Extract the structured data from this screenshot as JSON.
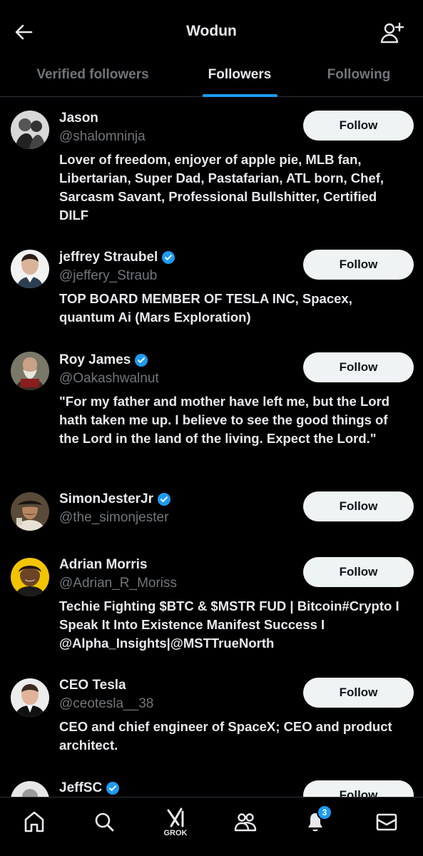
{
  "header": {
    "title": "Wodun",
    "back_icon": "arrow-left-icon",
    "add_user_icon": "person-add-icon"
  },
  "tabs": [
    {
      "label": "Verified followers",
      "active": false
    },
    {
      "label": "Followers",
      "active": true
    },
    {
      "label": "Following",
      "active": false
    }
  ],
  "colors": {
    "background": "#000000",
    "accent": "#1d9bf0",
    "secondary_text": "#71767b",
    "button_bg": "#eff3f4"
  },
  "followers": [
    {
      "name": "Jason",
      "handle": "@shalomninja",
      "verified": false,
      "bio": "Lover of freedom, enjoyer of apple pie, MLB fan, Libertarian, Super Dad, Pastafarian, ATL born, Chef, Sarcasm Savant, Professional Bullshitter, Certified DILF",
      "button": "Follow"
    },
    {
      "name": "jeffrey Straubel",
      "handle": "@jeffery_Straub",
      "verified": true,
      "bio": "TOP BOARD MEMBER OF TESLA INC, Spacex, quantum Ai (Mars Exploration)",
      "button": "Follow"
    },
    {
      "name": "Roy James",
      "handle": "@Oakashwalnut",
      "verified": true,
      "bio": "\"For my father and mother have left me, but the Lord hath taken me up. I believe to see the good things of the Lord in the land of the living. Expect the Lord.\"",
      "button": "Follow"
    },
    {
      "name": "SimonJesterJr",
      "handle": "@the_simonjester",
      "verified": true,
      "bio": "",
      "button": "Follow"
    },
    {
      "name": "Adrian Morris",
      "handle": "@Adrian_R_Moriss",
      "verified": false,
      "bio": "Techie Fighting $BTC & $MSTR FUD | Bitcoin#Crypto I Speak It Into Existence Manifest Success I @Alpha_Insights|@MSTTrueNorth",
      "button": "Follow"
    },
    {
      "name": "CEO Tesla",
      "handle": "@ceotesla__38",
      "verified": false,
      "bio": "CEO and chief engineer of SpaceX; CEO and product architect.",
      "button": "Follow"
    },
    {
      "name": "JeffSC",
      "handle": "",
      "verified": true,
      "bio": "",
      "button": "Follow"
    }
  ],
  "bottom_nav": {
    "items": [
      {
        "icon": "home-icon"
      },
      {
        "icon": "search-icon"
      },
      {
        "icon": "grok-icon",
        "label": "GROK"
      },
      {
        "icon": "communities-icon"
      },
      {
        "icon": "bell-icon",
        "badge": "3"
      },
      {
        "icon": "mail-icon"
      }
    ]
  }
}
